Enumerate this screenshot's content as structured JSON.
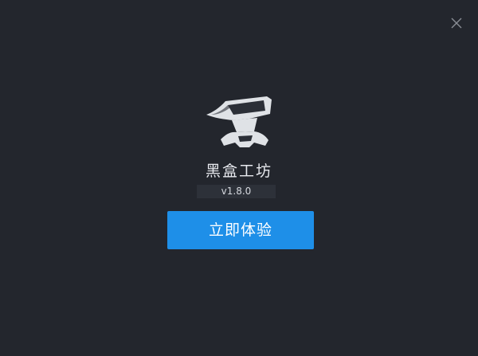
{
  "app": {
    "name": "黑盒工坊",
    "version": "v1.8.0"
  },
  "actions": {
    "start_label": "立即体验"
  },
  "icons": {
    "close": "close-icon",
    "logo": "anvil-logo-icon"
  },
  "colors": {
    "background": "#23262d",
    "accent": "#1e8fe8",
    "version_badge": "#2d3139"
  }
}
